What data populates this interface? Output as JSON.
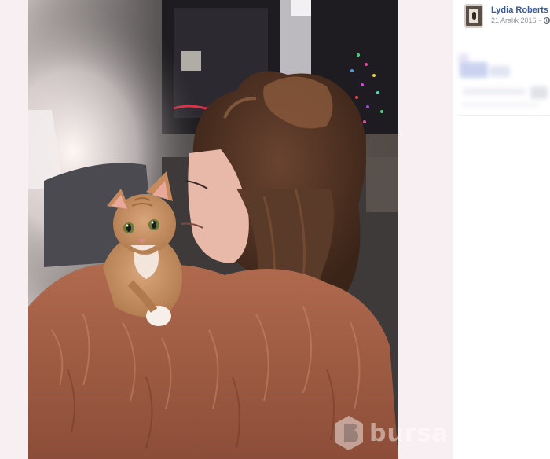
{
  "post": {
    "author": "Lydia Roberts",
    "date": "21 Aralık 2016",
    "separator": "·",
    "privacy_icon": "globe-icon"
  },
  "photo": {
    "subject_icon": "photo-image",
    "watermark_text": "bursa"
  },
  "colors": {
    "author_link": "#385898",
    "meta_gray": "#90949c",
    "viewer_bg": "#f8eff3",
    "panel_bg": "#ffffff"
  }
}
